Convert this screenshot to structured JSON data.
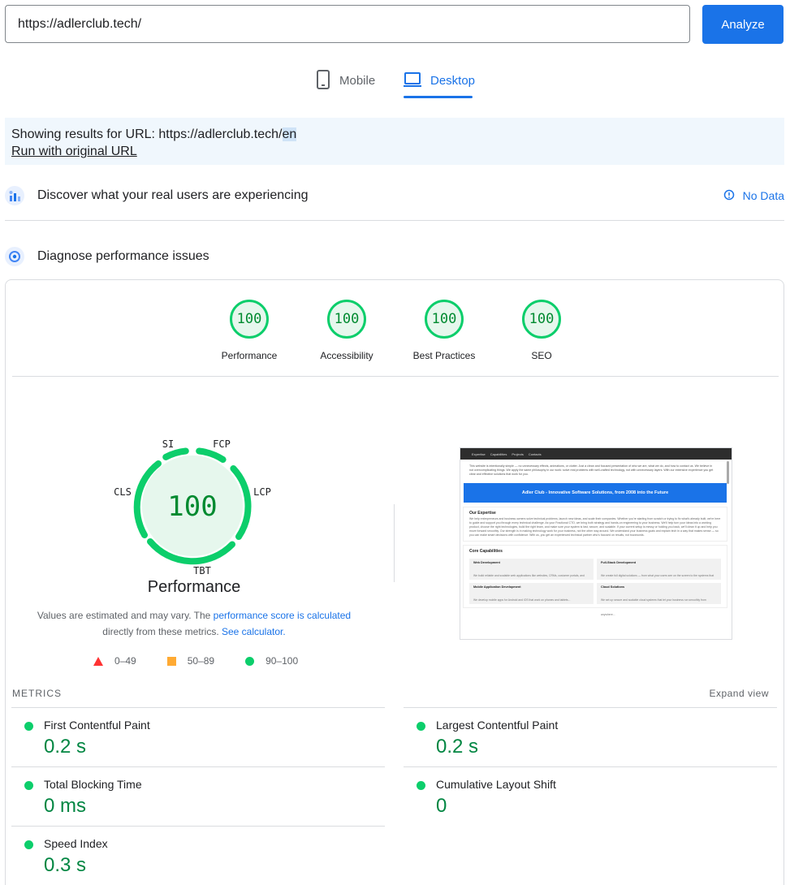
{
  "search": {
    "url_value": "https://adlerclub.tech/",
    "analyze_label": "Analyze"
  },
  "tabs": {
    "mobile": "Mobile",
    "desktop": "Desktop"
  },
  "notice": {
    "prefix": "Showing results for URL: https://adlerclub.tech/",
    "highlight": "en",
    "run_original": "Run with original URL"
  },
  "crux": {
    "title": "Discover what your real users are experiencing",
    "no_data": "No Data"
  },
  "diagnose": {
    "title": "Diagnose performance issues"
  },
  "scores": [
    {
      "value": "100",
      "label": "Performance"
    },
    {
      "value": "100",
      "label": "Accessibility"
    },
    {
      "value": "100",
      "label": "Best Practices"
    },
    {
      "value": "100",
      "label": "SEO"
    }
  ],
  "gauge": {
    "score": "100",
    "label": "Performance",
    "metric_labels": {
      "si": "SI",
      "fcp": "FCP",
      "lcp": "LCP",
      "tbt": "TBT",
      "cls": "CLS"
    }
  },
  "explain": {
    "part1": "Values are estimated and may vary. The ",
    "link1": "performance score is calculated",
    "part2": "directly from these metrics. ",
    "link2": "See calculator."
  },
  "legend": {
    "fail": "0–49",
    "average": "50–89",
    "pass": "90–100"
  },
  "screenshot": {
    "nav": [
      "Expertise",
      "Capabilities",
      "Projects",
      "Contacts"
    ],
    "intro": "This website is intentionally simple — no unnecessary effects, animations, or clutter. Just a clean and focused presentation of who we are, what we do, and how to contact us. We believe in not overcomplicating things. We apply the same philosophy in our work: solve real problems with well-crafted technology, not with unnecessary layers. With our extensive experience you get clear and effective solutions that work for you.",
    "banner": "Adler Club - Innovative Software Solutions, from 2008 into the Future",
    "expertise_title": "Our Expertise",
    "expertise_text": "We help entrepreneurs and business owners solve technical problems, launch new ideas, and scale their companies. Whether you're starting from scratch or trying to fix what's already built, we're here to guide and support you through every technical challenge. As your Fractional CTO, we bring both strategy and hands-on engineering to your business. We'll help turn your ideas into a working product, choose the right technologies, build the right team, and make sure your system is fast, secure, and scalable. If your current setup is messy or holding you back, we'll clean it up and help you move forward smoothly. Our strength is in making technology work for your business, not the other way around. We understand your business goals and explain tech in a way that makes sense — so you can make smart decisions with confidence. With us, you get an experienced technical partner who's focused on results, not buzzwords.",
    "core_title": "Core Capabilities",
    "cells": [
      {
        "title": "Web Development",
        "text": "We build reliable and scalable web applications like websites, CRMs, customer portals, and dashboards..."
      },
      {
        "title": "Full-Stack Development",
        "text": "We create full digital solutions — from what your users see on the screen to the systems that run in the background..."
      },
      {
        "title": "Mobile Application Development",
        "text": "We develop mobile apps for Android and iOS that work on phones and tablets..."
      },
      {
        "title": "Cloud Solutions",
        "text": "We set up secure and scalable cloud systems that let your business run smoothly from anywhere..."
      }
    ]
  },
  "metrics": {
    "heading": "METRICS",
    "expand": "Expand view",
    "items": [
      {
        "name": "First Contentful Paint",
        "value": "0.2 s"
      },
      {
        "name": "Largest Contentful Paint",
        "value": "0.2 s"
      },
      {
        "name": "Total Blocking Time",
        "value": "0 ms"
      },
      {
        "name": "Cumulative Layout Shift",
        "value": "0"
      },
      {
        "name": "Speed Index",
        "value": "0.3 s"
      }
    ]
  },
  "colors": {
    "accent": "#1a73e8",
    "pass": "#0cce6b",
    "pass_text": "#018642",
    "average": "#ffaa33",
    "fail": "#ff3333"
  }
}
